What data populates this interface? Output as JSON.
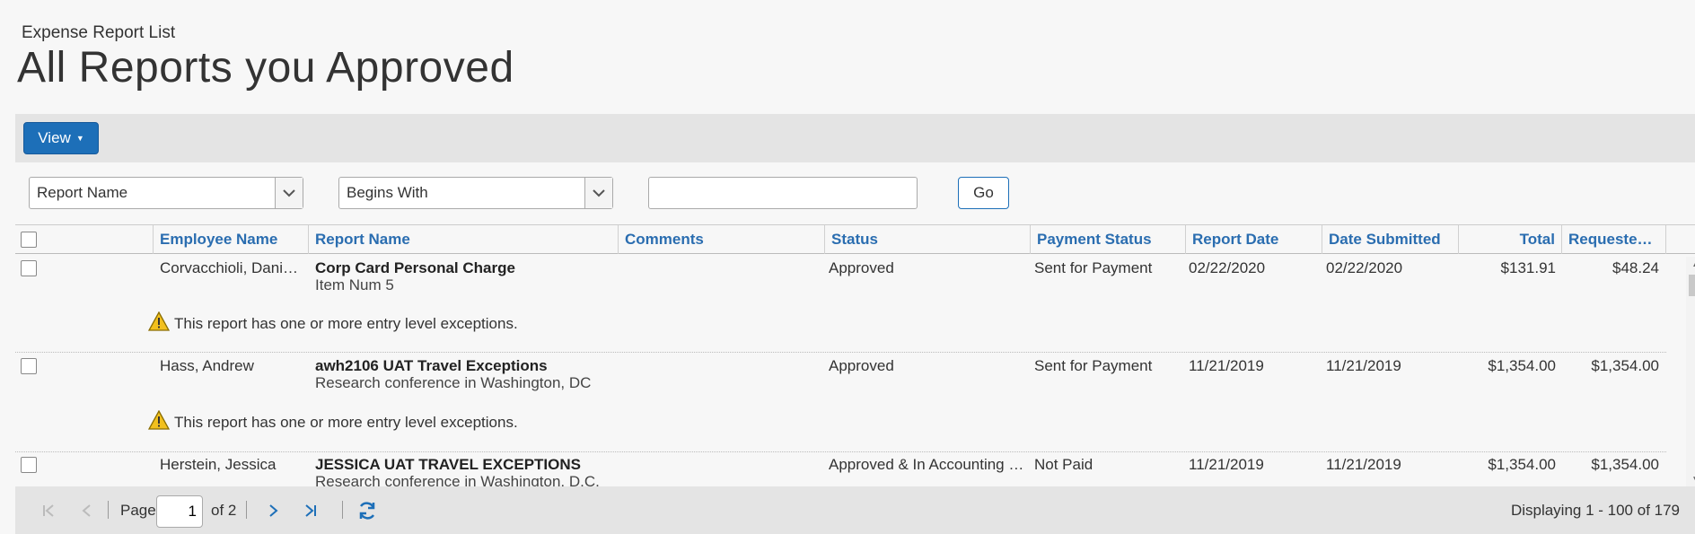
{
  "page": {
    "subtitle": "Expense Report List",
    "title": "All Reports you Approved"
  },
  "toolbar": {
    "view_label": "View"
  },
  "filters": {
    "field_select": "Report Name",
    "operator_select": "Begins With",
    "search_value": "",
    "go_label": "Go"
  },
  "columns": {
    "employee_name": "Employee Name",
    "report_name": "Report Name",
    "comments": "Comments",
    "status": "Status",
    "payment_status": "Payment Status",
    "report_date": "Report Date",
    "date_submitted": "Date Submitted",
    "total": "Total",
    "requested": "Requeste…"
  },
  "rows": [
    {
      "employee": "Corvacchioli, Dani…",
      "report_name": "Corp Card Personal Charge",
      "report_sub": "Item Num 5",
      "comments": "",
      "status": "Approved",
      "payment_status": "Sent for Payment",
      "report_date": "02/22/2020",
      "date_submitted": "02/22/2020",
      "total": "$131.91",
      "requested": "$48.24",
      "exception": "This report has one or more entry level exceptions."
    },
    {
      "employee": "Hass, Andrew",
      "report_name": "awh2106 UAT Travel Exceptions",
      "report_sub": "Research conference in Washington, DC",
      "comments": "",
      "status": "Approved",
      "payment_status": "Sent for Payment",
      "report_date": "11/21/2019",
      "date_submitted": "11/21/2019",
      "total": "$1,354.00",
      "requested": "$1,354.00",
      "exception": "This report has one or more entry level exceptions."
    },
    {
      "employee": "Herstein, Jessica",
      "report_name": "JESSICA UAT TRAVEL EXCEPTIONS",
      "report_sub": "Research conference in Washington, D.C.",
      "comments": "",
      "status": "Approved & In Accounting …",
      "payment_status": "Not Paid",
      "report_date": "11/21/2019",
      "date_submitted": "11/21/2019",
      "total": "$1,354.00",
      "requested": "$1,354.00"
    }
  ],
  "pager": {
    "page_label": "Page",
    "page_value": "1",
    "of_label": "of 2",
    "displaying": "Displaying 1 - 100 of 179"
  },
  "colors": {
    "accent": "#1d6fb8",
    "header_link": "#2a6db0",
    "warning": "#f2c01e"
  }
}
